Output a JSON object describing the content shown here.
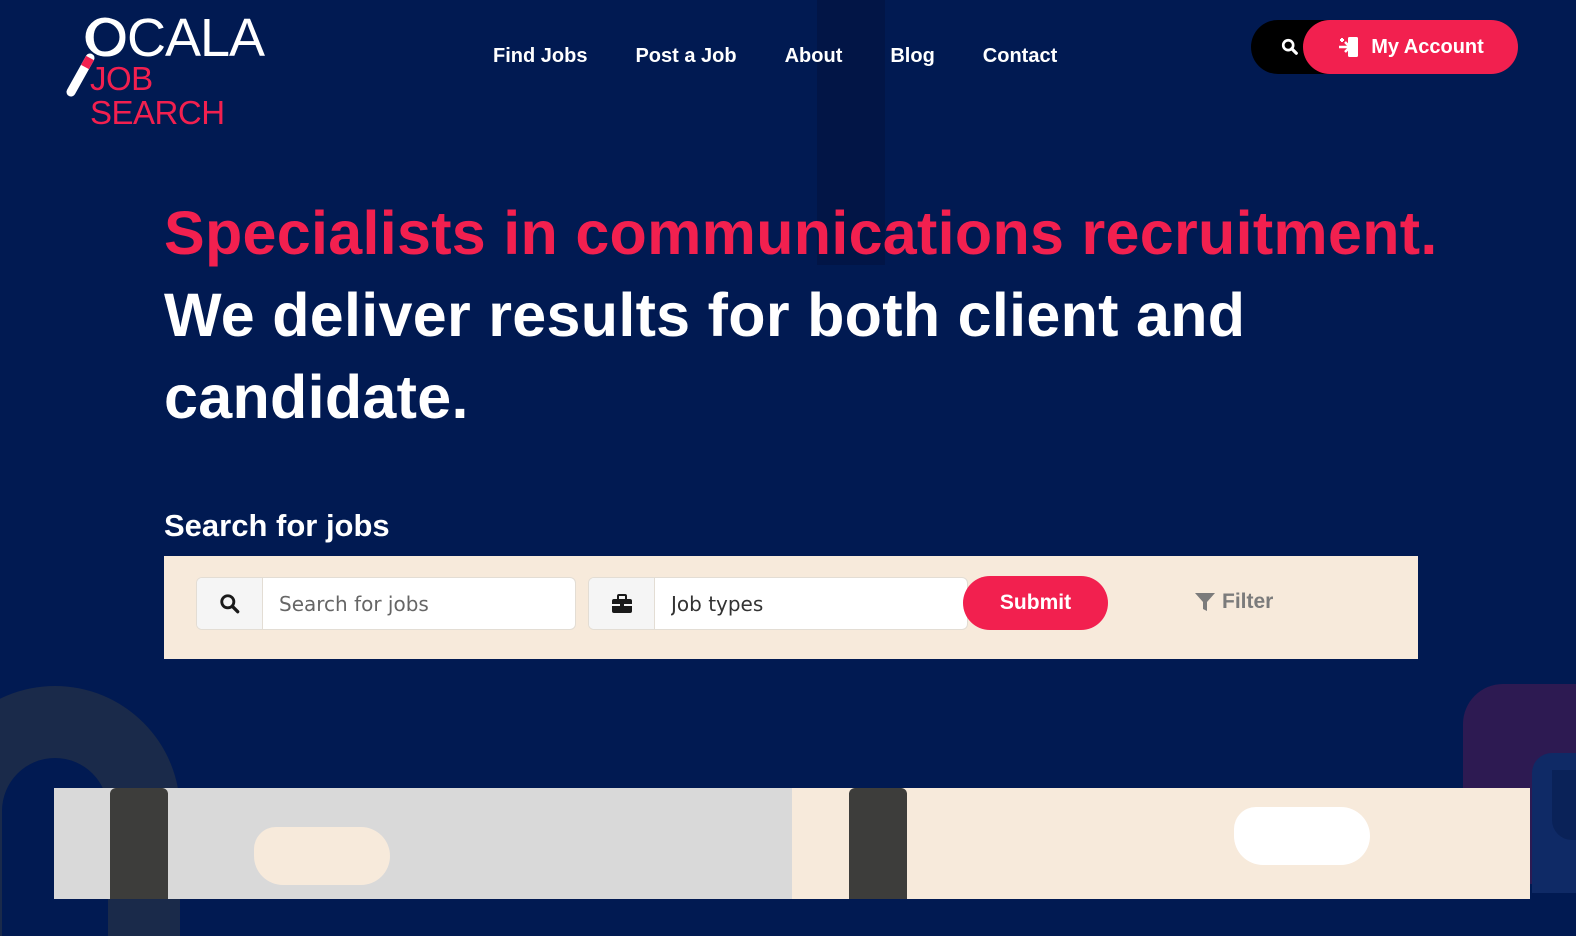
{
  "brand": {
    "name_top": "OCALA",
    "name_bottom": "JOB SEARCH",
    "accent": "#f2204f",
    "background": "#011a52"
  },
  "nav": {
    "items": [
      "Find Jobs",
      "Post a Job",
      "About",
      "Blog",
      "Contact"
    ]
  },
  "header": {
    "search_icon": "search-icon",
    "account_label": "My Account",
    "account_icon": "login-icon"
  },
  "hero": {
    "line_pink": "Specialists in communications recruitment.",
    "line_white": "We deliver results for both client and candidate."
  },
  "search": {
    "heading": "Search for jobs",
    "keyword_placeholder": "Search for jobs",
    "keyword_icon": "search-icon",
    "type_value": "Job types",
    "type_icon": "briefcase-icon",
    "submit_label": "Submit",
    "filter_label": "Filter",
    "filter_icon": "filter-icon"
  }
}
